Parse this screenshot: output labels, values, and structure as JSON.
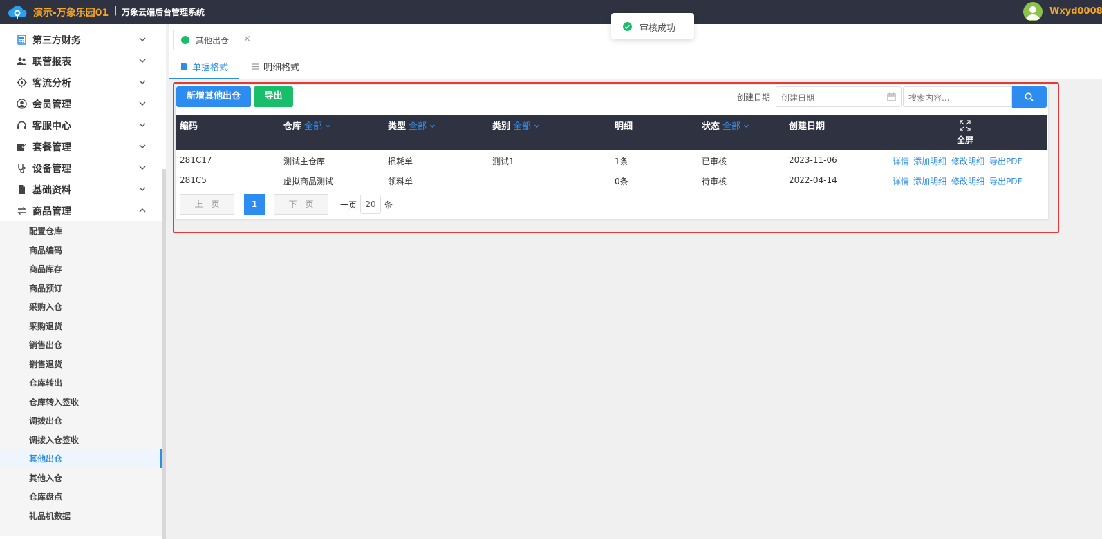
{
  "header": {
    "app_name": "演示-万象乐园01",
    "separator": "|",
    "system_name": "万象云端后台管理系统",
    "username": "Wxyd0008"
  },
  "sidebar": {
    "items": [
      {
        "label": "第三方财务",
        "icon": "calculator-icon"
      },
      {
        "label": "联营报表",
        "icon": "users-icon"
      },
      {
        "label": "客流分析",
        "icon": "target-icon"
      },
      {
        "label": "会员管理",
        "icon": "member-icon"
      },
      {
        "label": "客服中心",
        "icon": "headset-icon"
      },
      {
        "label": "套餐管理",
        "icon": "edit-icon"
      },
      {
        "label": "设备管理",
        "icon": "device-icon"
      },
      {
        "label": "基础资料",
        "icon": "file-icon"
      },
      {
        "label": "商品管理",
        "icon": "swap-icon"
      }
    ],
    "subitems": [
      "配置仓库",
      "商品编码",
      "商品库存",
      "商品预订",
      "采购入仓",
      "采购退货",
      "销售出仓",
      "销售退货",
      "仓库转出",
      "仓库转入签收",
      "调拨出仓",
      "调拨入仓签收",
      "其他出仓",
      "其他入仓",
      "仓库盘点",
      "礼品机数据"
    ],
    "active_subitem": "其他出仓"
  },
  "tabs": {
    "page_tab_label": "其他出仓",
    "close_glyph": "×",
    "view_tabs": [
      "单据格式",
      "明细格式"
    ]
  },
  "toast": {
    "message": "审核成功"
  },
  "toolbar": {
    "new_label": "新增其他出仓",
    "export_label": "导出",
    "date_label": "创建日期",
    "date_placeholder": "创建日期",
    "search_placeholder": "搜索内容..."
  },
  "table": {
    "columns": [
      {
        "label": "编码",
        "filter": ""
      },
      {
        "label": "仓库",
        "filter": "全部"
      },
      {
        "label": "类型",
        "filter": "全部"
      },
      {
        "label": "类别",
        "filter": "全部"
      },
      {
        "label": "明细",
        "filter": ""
      },
      {
        "label": "状态",
        "filter": "全部"
      },
      {
        "label": "创建日期",
        "filter": ""
      }
    ],
    "fullscreen_label": "全屏",
    "rows": [
      {
        "code": "281C17",
        "warehouse": "测试主仓库",
        "type": "损耗单",
        "category": "测试1",
        "detail": "1条",
        "status": "已审核",
        "date": "2023-11-06"
      },
      {
        "code": "281C5",
        "warehouse": "虚拟商品测试",
        "type": "领料单",
        "category": "",
        "detail": "0条",
        "status": "待审核",
        "date": "2022-04-14"
      }
    ],
    "actions": [
      "详情",
      "添加明细",
      "修改明细",
      "导出PDF"
    ]
  },
  "pager": {
    "prev_label": "上一页",
    "current_page": "1",
    "next_label": "下一页",
    "per_page_prefix": "一页",
    "page_size": "20",
    "per_page_suffix": "条"
  },
  "colors": {
    "topbar": "#2f3240",
    "brand": "#f5a623",
    "primary": "#2d8cf0",
    "success": "#19be6b",
    "highlight_frame": "#e53935"
  }
}
